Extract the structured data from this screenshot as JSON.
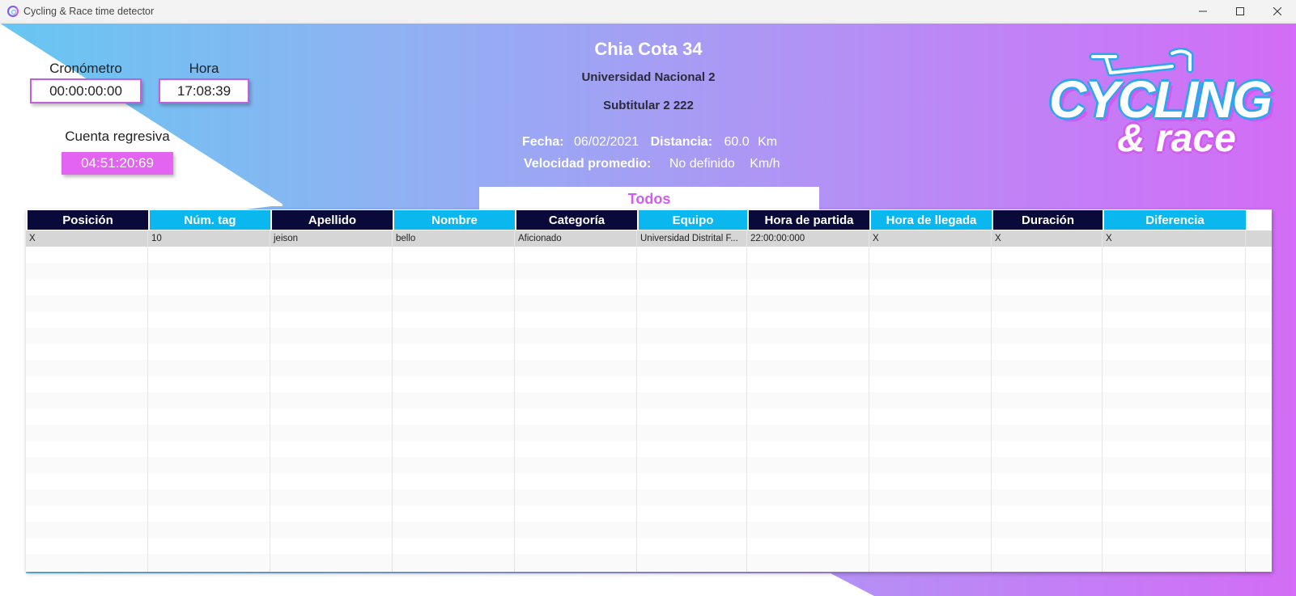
{
  "window": {
    "title": "Cycling & Race time detector"
  },
  "clocks": {
    "chrono_label": "Cronómetro",
    "chrono_value": "00:00:00:00",
    "hour_label": "Hora",
    "hour_value": "17:08:39",
    "countdown_label": "Cuenta regresiva",
    "countdown_value": "04:51:20:69"
  },
  "race": {
    "title": "Chia Cota 34",
    "subtitle1": "Universidad Nacional 2",
    "subtitle2": "Subtitular 2  222",
    "date_label": "Fecha:",
    "date_value": "06/02/2021",
    "distance_label": "Distancia:",
    "distance_value": "60.0",
    "distance_unit": "Km",
    "speed_label": "Velocidad promedio:",
    "speed_value": "No definido",
    "speed_unit": "Km/h"
  },
  "logo": {
    "line1": "CYCLING",
    "line2": "& race"
  },
  "filter": {
    "label": "Todos"
  },
  "table": {
    "columns": [
      "Posición",
      "Núm. tag",
      "Apellido",
      "Nombre",
      "Categoría",
      "Equipo",
      "Hora de partida",
      "Hora de llegada",
      "Duración",
      "Diferencia"
    ],
    "rows": [
      [
        "X",
        "10",
        "jeison",
        "bello",
        "Aficionado",
        "Universidad Distrital F...",
        "22:00:00:000",
        "X",
        "X",
        "X"
      ]
    ]
  },
  "colors": {
    "header_dark": "#0a0a3a",
    "header_cyan": "#0bb7ef",
    "accent_pink": "#d35cf0",
    "countdown_bg": "#e264f0"
  }
}
